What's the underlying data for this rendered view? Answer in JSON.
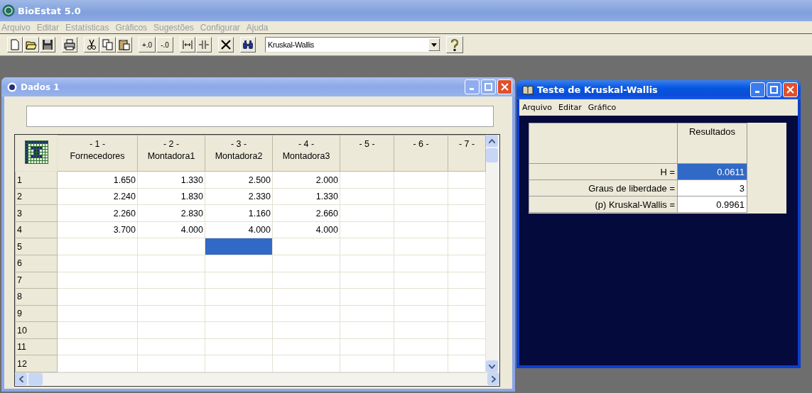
{
  "window": {
    "title": "BioEstat 5.0"
  },
  "menu": [
    {
      "label": "Arquivo",
      "disabled": true
    },
    {
      "label": "Editar",
      "disabled": true
    },
    {
      "label": "Estatísticas",
      "disabled": true
    },
    {
      "label": "Gráficos",
      "disabled": true
    },
    {
      "label": "Sugestões",
      "disabled": true
    },
    {
      "label": "Configurar",
      "disabled": true
    },
    {
      "label": "Ajuda",
      "disabled": true
    }
  ],
  "toolbar": [
    [
      {
        "kind": "new"
      },
      {
        "kind": "open"
      },
      {
        "kind": "save"
      }
    ],
    [
      {
        "kind": "print"
      }
    ],
    [
      {
        "kind": "cut"
      },
      {
        "kind": "copy"
      },
      {
        "kind": "paste"
      }
    ],
    [
      {
        "kind": "text",
        "label": "+.0"
      },
      {
        "kind": "text",
        "label": "-.0"
      }
    ],
    [
      {
        "kind": "widen"
      },
      {
        "kind": "narrow"
      }
    ],
    [
      {
        "kind": "delete"
      }
    ],
    [
      {
        "kind": "find"
      }
    ]
  ],
  "test_select": {
    "value": "Kruskal-Wallis"
  },
  "data_window": {
    "title": "Dados 1",
    "active": false,
    "columns": [
      {
        "number": "- 1 -",
        "name": "Fornecedores"
      },
      {
        "number": "- 2 -",
        "name": "Montadora1"
      },
      {
        "number": "- 3 -",
        "name": "Montadora2"
      },
      {
        "number": "- 4 -",
        "name": "Montadora3"
      },
      {
        "number": "- 5 -"
      },
      {
        "number": "- 6 -"
      },
      {
        "number": "- 7 -"
      }
    ],
    "rows": [
      {
        "number": "1",
        "cells": [
          {
            "text": "1.650",
            "selected": false
          },
          {
            "text": "1.330",
            "selected": false
          },
          {
            "text": "2.500",
            "selected": false
          },
          {
            "text": "2.000",
            "selected": false
          },
          {
            "selected": false
          },
          {
            "selected": false
          },
          {
            "selected": false
          }
        ]
      },
      {
        "number": "2",
        "cells": [
          {
            "text": "2.240",
            "selected": false
          },
          {
            "text": "1.830",
            "selected": false
          },
          {
            "text": "2.330",
            "selected": false
          },
          {
            "text": "1.330",
            "selected": false
          },
          {
            "selected": false
          },
          {
            "selected": false
          },
          {
            "selected": false
          }
        ]
      },
      {
        "number": "3",
        "cells": [
          {
            "text": "2.260",
            "selected": false
          },
          {
            "text": "2.830",
            "selected": false
          },
          {
            "text": "1.160",
            "selected": false
          },
          {
            "text": "2.660",
            "selected": false
          },
          {
            "selected": false
          },
          {
            "selected": false
          },
          {
            "selected": false
          }
        ]
      },
      {
        "number": "4",
        "cells": [
          {
            "text": "3.700",
            "selected": false
          },
          {
            "text": "4.000",
            "selected": false
          },
          {
            "text": "4.000",
            "selected": false
          },
          {
            "text": "4.000",
            "selected": false
          },
          {
            "selected": false
          },
          {
            "selected": false
          },
          {
            "selected": false
          }
        ]
      },
      {
        "number": "5",
        "cells": [
          {
            "selected": false
          },
          {
            "selected": false
          },
          {
            "selected": true
          },
          {
            "selected": false
          },
          {
            "selected": false
          },
          {
            "selected": false
          },
          {
            "selected": false
          }
        ]
      },
      {
        "number": "6",
        "cells": [
          {
            "selected": false
          },
          {
            "selected": false
          },
          {
            "selected": false
          },
          {
            "selected": false
          },
          {
            "selected": false
          },
          {
            "selected": false
          },
          {
            "selected": false
          }
        ]
      },
      {
        "number": "7",
        "cells": [
          {
            "selected": false
          },
          {
            "selected": false
          },
          {
            "selected": false
          },
          {
            "selected": false
          },
          {
            "selected": false
          },
          {
            "selected": false
          },
          {
            "selected": false
          }
        ]
      },
      {
        "number": "8",
        "cells": [
          {
            "selected": false
          },
          {
            "selected": false
          },
          {
            "selected": false
          },
          {
            "selected": false
          },
          {
            "selected": false
          },
          {
            "selected": false
          },
          {
            "selected": false
          }
        ]
      },
      {
        "number": "9",
        "cells": [
          {
            "selected": false
          },
          {
            "selected": false
          },
          {
            "selected": false
          },
          {
            "selected": false
          },
          {
            "selected": false
          },
          {
            "selected": false
          },
          {
            "selected": false
          }
        ]
      },
      {
        "number": "10",
        "cells": [
          {
            "selected": false
          },
          {
            "selected": false
          },
          {
            "selected": false
          },
          {
            "selected": false
          },
          {
            "selected": false
          },
          {
            "selected": false
          },
          {
            "selected": false
          }
        ]
      },
      {
        "number": "11",
        "cells": [
          {
            "selected": false
          },
          {
            "selected": false
          },
          {
            "selected": false
          },
          {
            "selected": false
          },
          {
            "selected": false
          },
          {
            "selected": false
          },
          {
            "selected": false
          }
        ]
      },
      {
        "number": "12",
        "cells": [
          {
            "selected": false
          },
          {
            "selected": false
          },
          {
            "selected": false
          },
          {
            "selected": false
          },
          {
            "selected": false
          },
          {
            "selected": false
          },
          {
            "selected": false
          }
        ]
      }
    ]
  },
  "results_window": {
    "title": "Teste de Kruskal-Wallis",
    "active": true,
    "menu": [
      {
        "label": "Arquivo",
        "disabled": false
      },
      {
        "label": "Editar",
        "disabled": false
      },
      {
        "label": "Gráfico",
        "disabled": false
      }
    ],
    "column_header": "Resultados",
    "rows": [
      {
        "label": "H =",
        "value": "0.0611",
        "selected": true
      },
      {
        "label": "Graus de liberdade =",
        "value": "3",
        "selected": false
      },
      {
        "label": "(p) Kruskal-Wallis =",
        "value": "0.9961",
        "selected": false
      }
    ]
  }
}
